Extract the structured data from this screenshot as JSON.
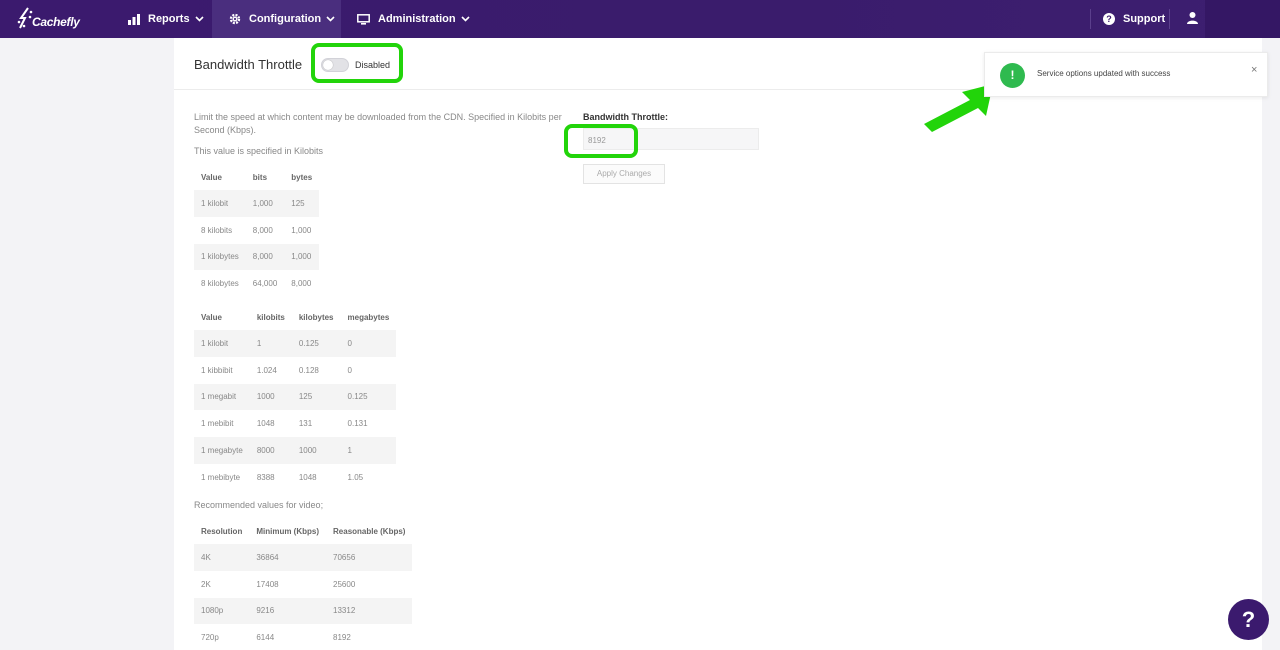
{
  "nav": {
    "brand": "Cachefly",
    "reports": "Reports",
    "configuration": "Configuration",
    "administration": "Administration",
    "support": "Support"
  },
  "page": {
    "title": "Bandwidth Throttle",
    "toggle_label": "Disabled",
    "description": "Limit the speed at which content may be downloaded from the CDN. Specified in Kilobits per Second (Kbps).",
    "unit_note": "This value is specified in Kilobits",
    "video_note": "Recommended values for video;"
  },
  "table1": {
    "headers": [
      "Value",
      "bits",
      "bytes"
    ],
    "rows": [
      [
        "1 kilobit",
        "1,000",
        "125"
      ],
      [
        "8 kilobits",
        "8,000",
        "1,000"
      ],
      [
        "1 kilobytes",
        "8,000",
        "1,000"
      ],
      [
        "8 kilobytes",
        "64,000",
        "8,000"
      ]
    ]
  },
  "table2": {
    "headers": [
      "Value",
      "kilobits",
      "kilobytes",
      "megabytes"
    ],
    "rows": [
      [
        "1 kilobit",
        "1",
        "0.125",
        "0"
      ],
      [
        "1 kibbibit",
        "1.024",
        "0.128",
        "0"
      ],
      [
        "1 megabit",
        "1000",
        "125",
        "0.125"
      ],
      [
        "1 mebibit",
        "1048",
        "131",
        "0.131"
      ],
      [
        "1 megabyte",
        "8000",
        "1000",
        "1"
      ],
      [
        "1 mebibyte",
        "8388",
        "1048",
        "1.05"
      ]
    ]
  },
  "table3": {
    "headers": [
      "Resolution",
      "Minimum (Kbps)",
      "Reasonable (Kbps)"
    ],
    "rows": [
      [
        "4K",
        "36864",
        "70656"
      ],
      [
        "2K",
        "17408",
        "25600"
      ],
      [
        "1080p",
        "9216",
        "13312"
      ],
      [
        "720p",
        "6144",
        "8192"
      ]
    ]
  },
  "form": {
    "label": "Bandwidth Throttle:",
    "value": "8192",
    "apply": "Apply Changes"
  },
  "toast": {
    "icon": "!",
    "message": "Service options updated with success",
    "close": "×"
  },
  "help": "?",
  "colors": {
    "nav_bg": "#3b1a6e",
    "highlight": "#22d40a",
    "success": "#2fba4f"
  }
}
